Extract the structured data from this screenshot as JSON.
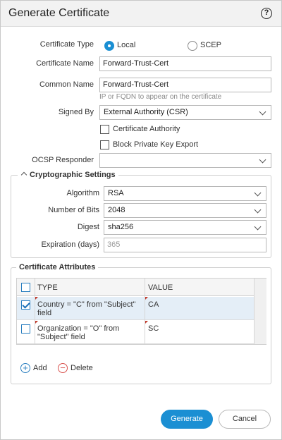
{
  "dialog": {
    "title": "Generate Certificate",
    "help_label": "?"
  },
  "form": {
    "certificate_type": {
      "label": "Certificate Type",
      "options": [
        "Local",
        "SCEP"
      ],
      "selected": "Local"
    },
    "certificate_name": {
      "label": "Certificate Name",
      "value": "Forward-Trust-Cert"
    },
    "common_name": {
      "label": "Common Name",
      "value": "Forward-Trust-Cert",
      "hint": "IP or FQDN to appear on the certificate"
    },
    "signed_by": {
      "label": "Signed By",
      "value": "External Authority (CSR)"
    },
    "certificate_authority_label": "Certificate Authority",
    "block_private_key_label": "Block Private Key Export",
    "ocsp_responder": {
      "label": "OCSP Responder",
      "value": ""
    }
  },
  "crypto": {
    "title": "Cryptographic Settings",
    "algorithm": {
      "label": "Algorithm",
      "value": "RSA"
    },
    "bits": {
      "label": "Number of Bits",
      "value": "2048"
    },
    "digest": {
      "label": "Digest",
      "value": "sha256"
    },
    "expiration": {
      "label": "Expiration (days)",
      "value": "365"
    }
  },
  "attributes": {
    "title": "Certificate Attributes",
    "columns": [
      "TYPE",
      "VALUE"
    ],
    "rows": [
      {
        "type_line1": "Country = \"C\" from \"Subject\"",
        "type_line2": "field",
        "value": "CA",
        "checked": true
      },
      {
        "type_line1": "Organization = \"O\" from",
        "type_line2": "\"Subject\" field",
        "value": "SC",
        "checked": false
      }
    ],
    "add_label": "Add",
    "delete_label": "Delete"
  },
  "footer": {
    "generate_label": "Generate",
    "cancel_label": "Cancel"
  },
  "colors": {
    "accent": "#1b8fd3",
    "delete": "#d9534f",
    "add": "#2a7fc0"
  }
}
